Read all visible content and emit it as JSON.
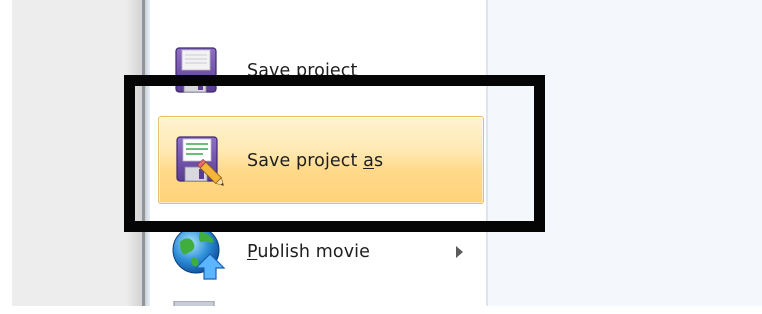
{
  "menu": {
    "items": [
      {
        "id": "save",
        "label": "Save project",
        "icon": "floppy-disk-icon"
      },
      {
        "id": "save_as",
        "label_before": "Save project ",
        "label_accel": "a",
        "label_after": "s",
        "icon": "floppy-disk-pencil-icon",
        "state": "highlighted"
      },
      {
        "id": "publish",
        "label_accel": "P",
        "label_after": "ublish movie",
        "icon": "globe-upload-icon",
        "has_submenu": true
      }
    ]
  },
  "colors": {
    "highlight_top": "#fff3d2",
    "highlight_bottom": "#ffd27a",
    "highlight_border": "#e6c16a",
    "annotation": "#050505"
  }
}
